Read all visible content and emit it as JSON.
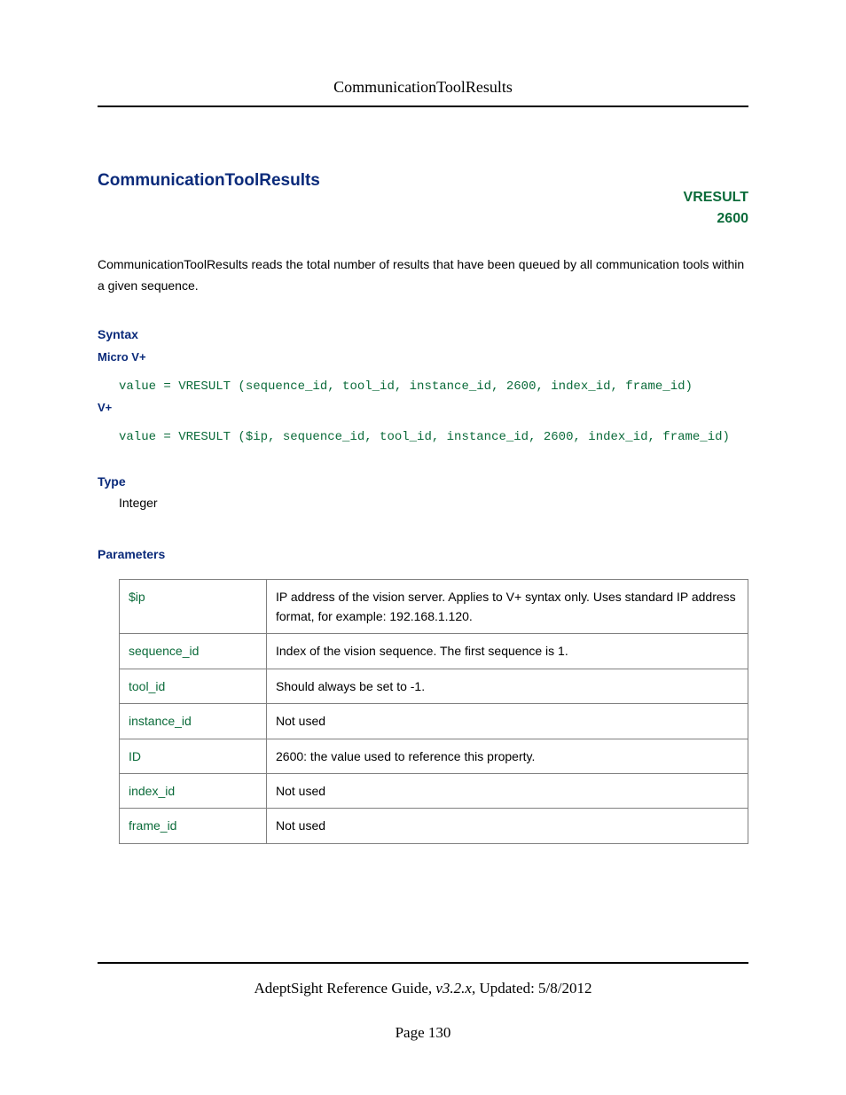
{
  "header": {
    "title": "CommunicationToolResults"
  },
  "title": "CommunicationToolResults",
  "badge": {
    "line1": "VRESULT",
    "line2": "2600"
  },
  "intro": "CommunicationToolResults reads the total number of results that have been queued by all communication tools within a given sequence.",
  "sections": {
    "syntax_label": "Syntax",
    "microv_label": "Micro V+",
    "microv_code": "value = VRESULT (sequence_id, tool_id, instance_id, 2600, index_id, frame_id)",
    "vplus_label": "V+",
    "vplus_code": "value = VRESULT ($ip, sequence_id, tool_id, instance_id, 2600, index_id, frame_id)",
    "type_label": "Type",
    "type_value": "Integer",
    "params_label": "Parameters"
  },
  "params": [
    {
      "name": "$ip",
      "desc": "IP address of the vision server. Applies to V+ syntax only. Uses standard IP address format, for example: 192.168.1.120."
    },
    {
      "name": "sequence_id",
      "desc": "Index of the vision sequence. The first sequence is 1."
    },
    {
      "name": "tool_id",
      "desc": "Should always be set to -1."
    },
    {
      "name": "instance_id",
      "desc": "Not used"
    },
    {
      "name": "ID",
      "desc": "2600: the value used to reference this property."
    },
    {
      "name": "index_id",
      "desc": "Not used"
    },
    {
      "name": "frame_id",
      "desc": "Not used"
    }
  ],
  "footer": {
    "guide": "AdeptSight Reference Guide",
    "version": ", v3.2.x",
    "updated": ", Updated: 5/8/2012",
    "page": "Page 130"
  }
}
